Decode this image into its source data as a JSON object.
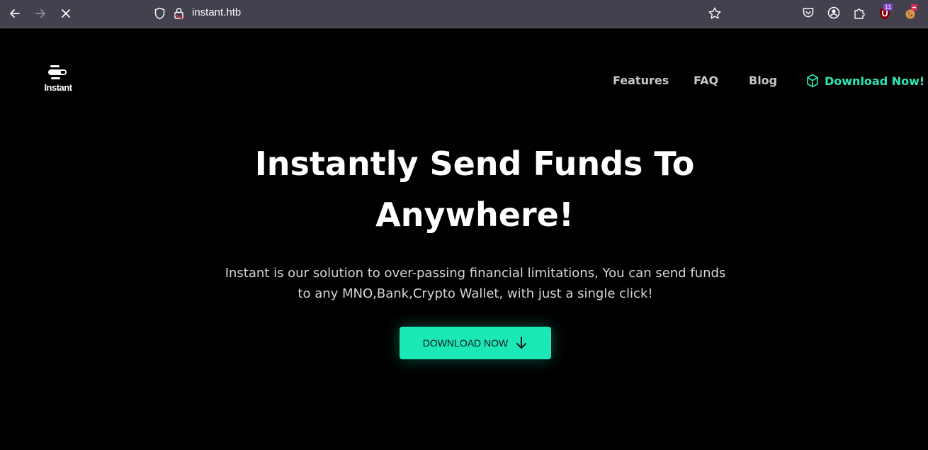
{
  "browser": {
    "url": "instant.htb",
    "extension_badge_count": "11",
    "icons": [
      "back-icon",
      "forward-icon",
      "stop-icon",
      "shield-icon",
      "lock-icon",
      "star-icon",
      "pocket-icon",
      "account-icon",
      "extensions-icon",
      "ublock-icon",
      "cookie-extension-icon"
    ]
  },
  "site": {
    "logo_text": "Instant",
    "nav": {
      "features": "Features",
      "faq": "FAQ",
      "blog": "Blog",
      "download": "Download Now!"
    },
    "hero": {
      "title_line1": "Instantly Send Funds To",
      "title_line2": "Anywhere!",
      "description_line1": "Instant is our solution to over-passing financial limitations, You can send funds",
      "description_line2": "to any MNO,Bank,Crypto Wallet, with just a single click!",
      "cta_label": "DOWNLOAD NOW"
    },
    "colors": {
      "background": "#000000",
      "accent": "#1ce7b7",
      "nav_text": "#c7c7c7",
      "browser_bar": "#42414d"
    }
  }
}
